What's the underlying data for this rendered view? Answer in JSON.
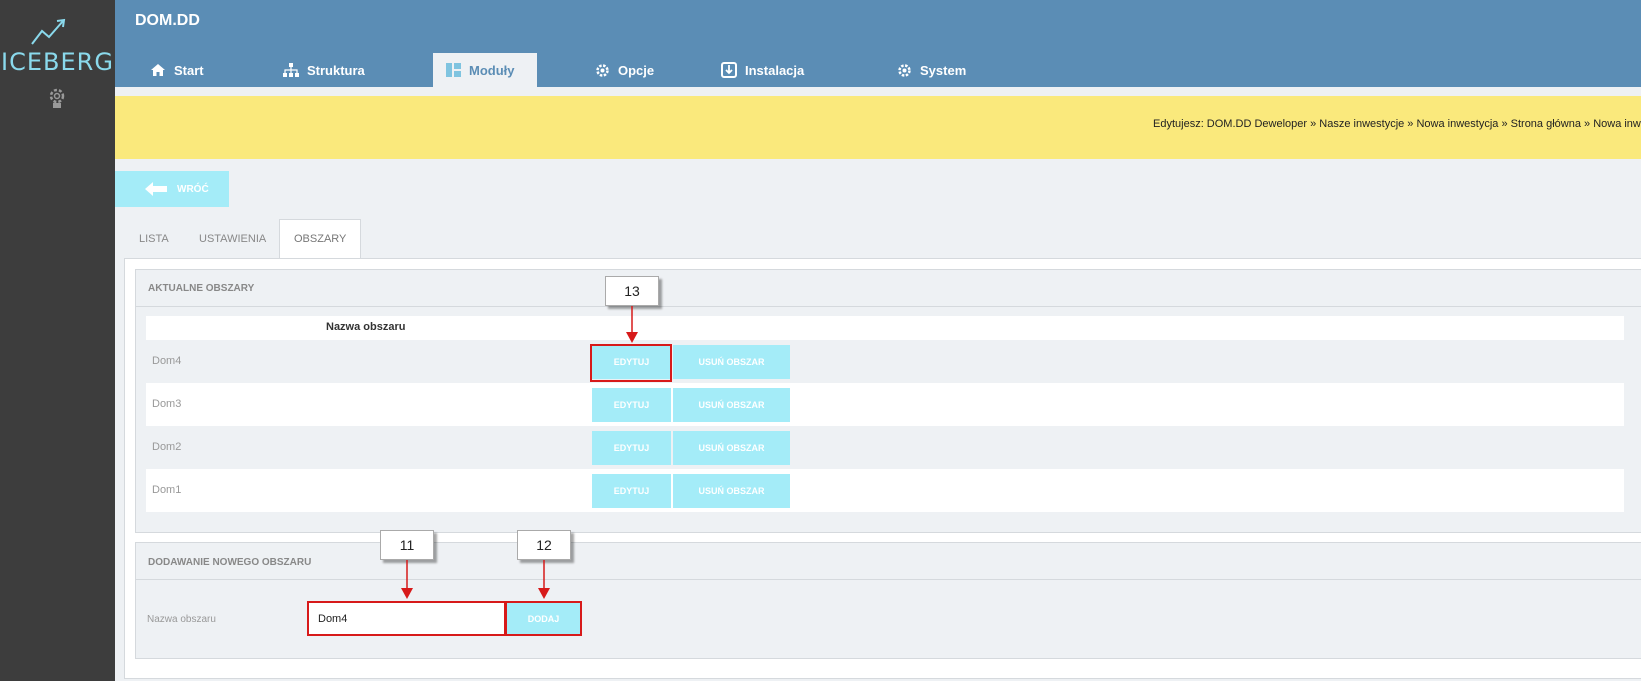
{
  "sidebar": {
    "brand": "ICEBERG"
  },
  "header": {
    "title": "DOM.DD",
    "tabs": [
      {
        "label": "Start",
        "icon": "home-icon"
      },
      {
        "label": "Struktura",
        "icon": "sitemap-icon"
      },
      {
        "label": "Moduły",
        "icon": "modules-icon",
        "active": true
      },
      {
        "label": "Opcje",
        "icon": "gear-icon"
      },
      {
        "label": "Instalacja",
        "icon": "install-icon"
      },
      {
        "label": "System",
        "icon": "gear-icon"
      }
    ]
  },
  "breadcrumb": "Edytujesz: DOM.DD Deweloper » Nasze inwestycje » Nowa inwestycja » Strona główna » Nowa inwe",
  "back_button": {
    "label": "WRÓĆ"
  },
  "content_tabs": [
    {
      "label": "LISTA"
    },
    {
      "label": "USTAWIENIA"
    },
    {
      "label": "OBSZARY",
      "active": true
    }
  ],
  "current_areas": {
    "title": "AKTUALNE OBSZARY",
    "column_header": "Nazwa obszaru",
    "edit_label": "EDYTUJ",
    "delete_label": "USUŃ OBSZAR",
    "rows": [
      {
        "name": "Dom4"
      },
      {
        "name": "Dom3"
      },
      {
        "name": "Dom2"
      },
      {
        "name": "Dom1"
      }
    ]
  },
  "new_area": {
    "title": "DODAWANIE NOWEGO OBSZARU",
    "field_label": "Nazwa obszaru",
    "field_value": "Dom4",
    "add_label": "DODAJ"
  },
  "annotations": {
    "a11": "11",
    "a12": "12",
    "a13": "13"
  },
  "colors": {
    "sidebar": "#3d3d3d",
    "header": "#5b8db5",
    "breadcrumb_bar": "#fae97c",
    "button": "#a4ecf8",
    "annotation": "#d71a1a",
    "brand": "#8ad9ec"
  }
}
